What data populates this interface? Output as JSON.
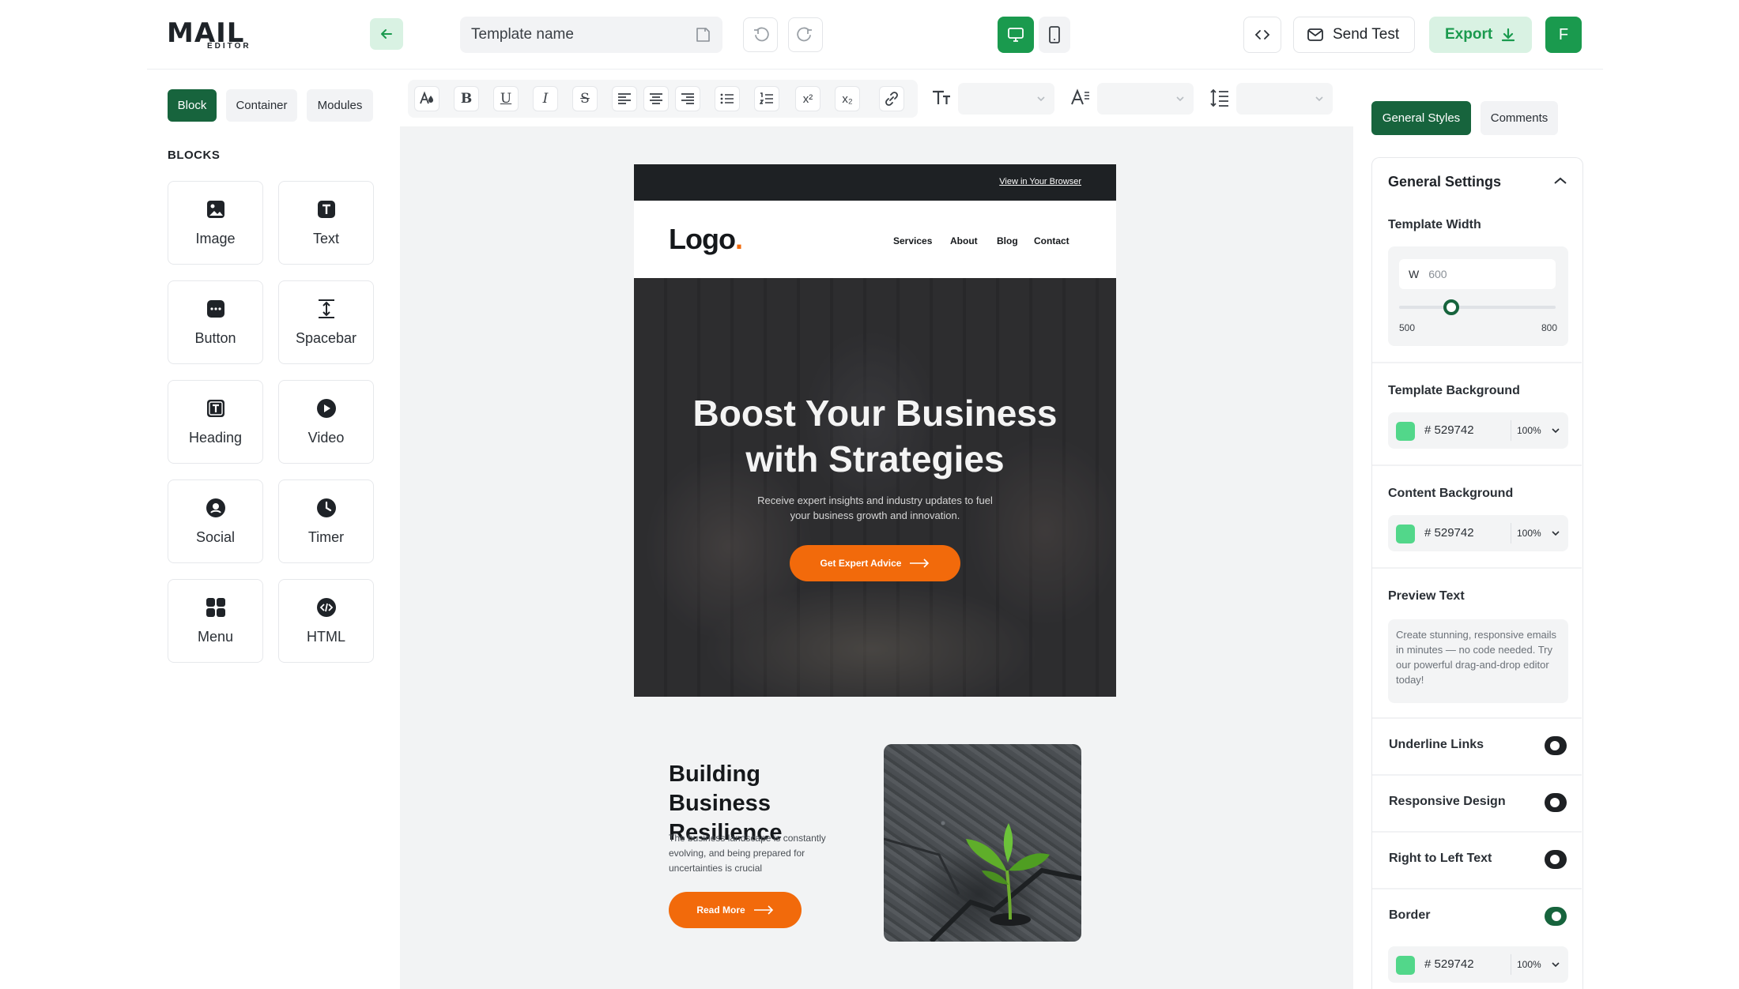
{
  "header": {
    "logo_text": "MAIL",
    "logo_sub": "EDITOR",
    "template_name_placeholder": "Template name",
    "send_test_label": "Send Test",
    "export_label": "Export",
    "avatar_initial": "F"
  },
  "sidebar": {
    "tabs": [
      {
        "label": "Block",
        "active": true
      },
      {
        "label": "Container",
        "active": false
      },
      {
        "label": "Modules",
        "active": false
      }
    ],
    "section_title": "BLOCKS",
    "blocks": [
      {
        "label": "Image",
        "icon": "image-icon"
      },
      {
        "label": "Text",
        "icon": "text-icon"
      },
      {
        "label": "Button",
        "icon": "button-icon"
      },
      {
        "label": "Spacebar",
        "icon": "spacebar-icon"
      },
      {
        "label": "Heading",
        "icon": "heading-icon"
      },
      {
        "label": "Video",
        "icon": "video-icon"
      },
      {
        "label": "Social",
        "icon": "social-icon"
      },
      {
        "label": "Timer",
        "icon": "timer-icon"
      },
      {
        "label": "Menu",
        "icon": "menu-icon"
      },
      {
        "label": "HTML",
        "icon": "html-icon"
      }
    ]
  },
  "toolbar": {
    "bold": "B",
    "underline": "U",
    "italic": "I",
    "strike": "S",
    "superscript": "x²",
    "subscript": "x₂",
    "font_size_icon": "TT"
  },
  "email": {
    "view_in_browser": "View in Your Browser",
    "logo": "Logo",
    "logo_dot": ".",
    "nav": [
      "Services",
      "About",
      "Blog",
      "Contact"
    ],
    "hero_title_line1": "Boost Your Business",
    "hero_title_line2": "with Strategies",
    "hero_text": "Receive expert insights and industry updates to fuel your business growth and innovation.",
    "hero_cta": "Get Expert Advice",
    "section_title": "Building Business Resilience",
    "section_text": "The business landscape is constantly evolving, and being prepared for uncertainties is crucial",
    "section_cta": "Read More"
  },
  "right_panel": {
    "tabs": [
      {
        "label": "General Styles",
        "active": true
      },
      {
        "label": "Comments",
        "active": false
      }
    ],
    "title": "General Settings",
    "template_width_label": "Template Width",
    "width_prefix": "W",
    "width_value": "600",
    "slider_min": "500",
    "slider_max": "800",
    "slider_value": 600,
    "template_bg_label": "Template Background",
    "template_bg_hex": "# 529742",
    "template_bg_opacity": "100%",
    "content_bg_label": "Content Background",
    "content_bg_hex": "# 529742",
    "content_bg_opacity": "100%",
    "preview_text_label": "Preview Text",
    "preview_text": "Create stunning, responsive emails in minutes — no code needed. Try our powerful drag-and-drop editor today!",
    "toggles": [
      {
        "label": "Underline Links",
        "on": false
      },
      {
        "label": "Responsive Design",
        "on": false
      },
      {
        "label": "Right to Left Text",
        "on": false
      },
      {
        "label": "Border",
        "on": true
      }
    ],
    "border_hex": "# 529742",
    "border_opacity": "100%"
  },
  "colors": {
    "brand_green": "#17643d",
    "accent_green": "#1a9a4e",
    "swatch": "#52d78a",
    "orange": "#f26a0b"
  }
}
